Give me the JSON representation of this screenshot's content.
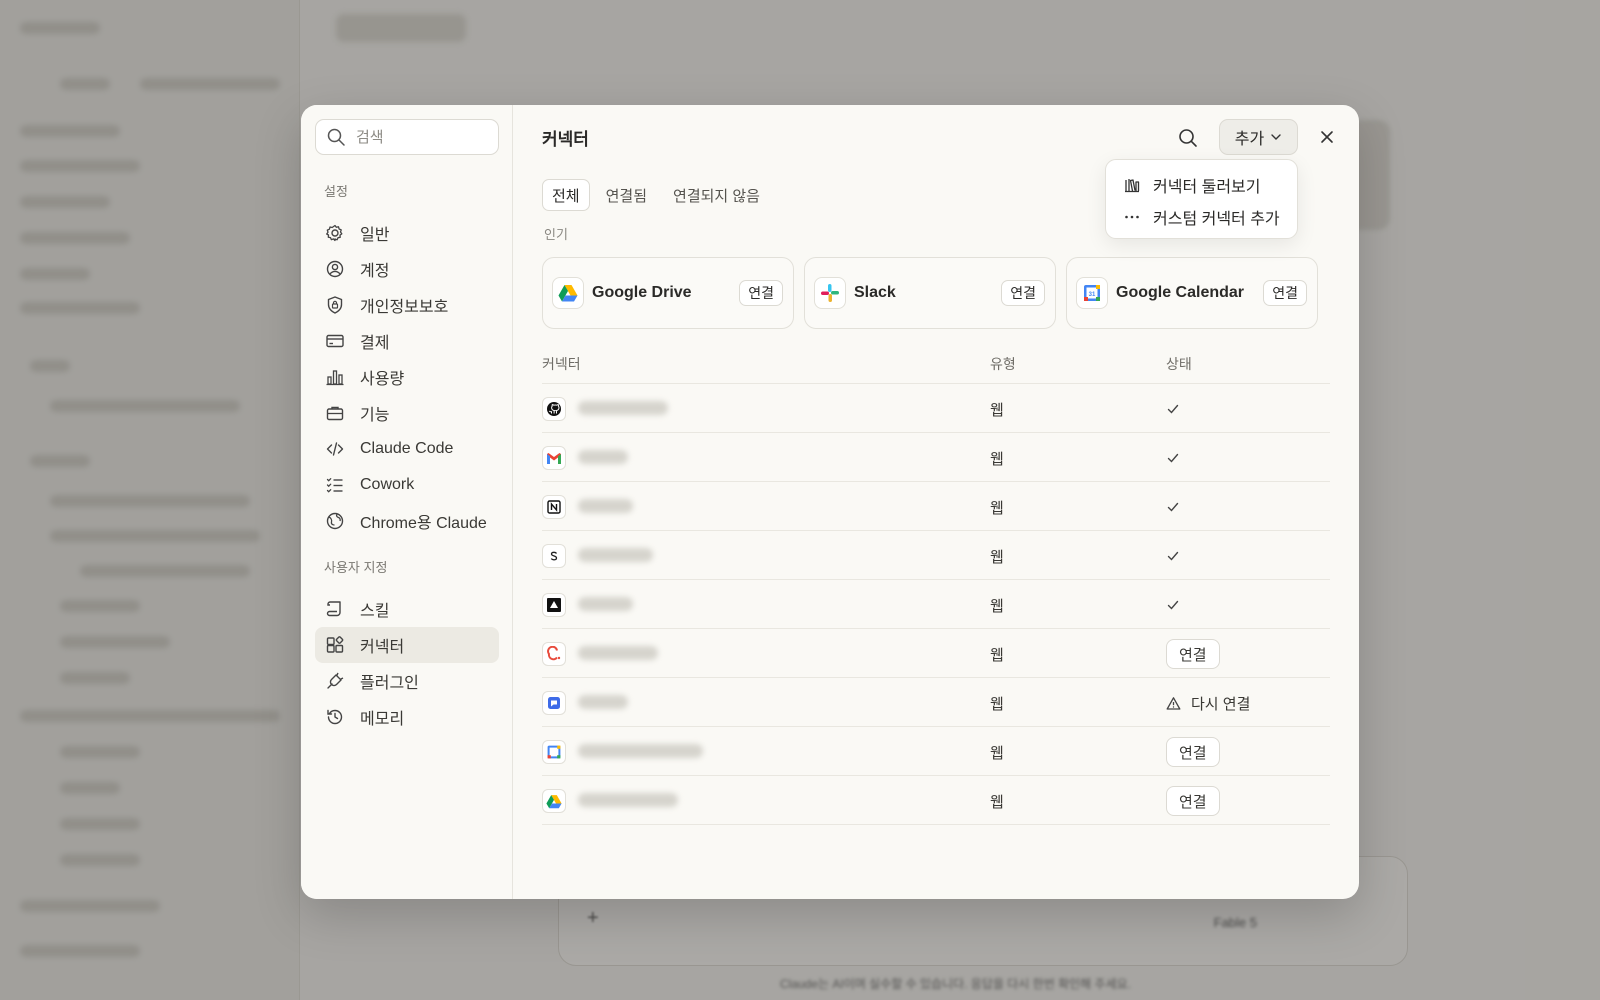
{
  "background": {
    "composer_model": "Fable 5",
    "disclaimer": "Claude는 AI이며 실수할 수 있습니다. 응답을 다시 한번 확인해 주세요."
  },
  "settings": {
    "search_placeholder": "검색",
    "section_settings": "설정",
    "nav": [
      {
        "label": "일반",
        "icon": "gear-icon"
      },
      {
        "label": "계정",
        "icon": "user-circle-icon"
      },
      {
        "label": "개인정보보호",
        "icon": "shield-lock-icon"
      },
      {
        "label": "결제",
        "icon": "credit-card-icon"
      },
      {
        "label": "사용량",
        "icon": "bar-chart-icon"
      },
      {
        "label": "기능",
        "icon": "briefcase-icon"
      },
      {
        "label": "Claude Code",
        "icon": "code-icon"
      },
      {
        "label": "Cowork",
        "icon": "checklist-icon"
      },
      {
        "label": "Chrome용 Claude",
        "icon": "globe-icon"
      }
    ],
    "section_custom": "사용자 지정",
    "custom_nav": [
      {
        "label": "스킬",
        "icon": "scroll-icon"
      },
      {
        "label": "커넥터",
        "icon": "connector-icon",
        "active": true
      },
      {
        "label": "플러그인",
        "icon": "plug-icon"
      },
      {
        "label": "메모리",
        "icon": "history-icon"
      }
    ]
  },
  "connectors": {
    "title": "커넥터",
    "add_label": "추가",
    "menu": [
      {
        "label": "커넥터 둘러보기",
        "icon": "library-icon"
      },
      {
        "label": "커스텀 커넥터 추가",
        "icon": "more-dots-icon"
      }
    ],
    "tabs": [
      "전체",
      "연결됨",
      "연결되지 않음"
    ],
    "active_tab": "전체",
    "popular_label": "인기",
    "popular": [
      {
        "name": "Google Drive",
        "action": "연결",
        "icon": "google-drive-icon"
      },
      {
        "name": "Slack",
        "action": "연결",
        "icon": "slack-icon"
      },
      {
        "name": "Google Calendar",
        "action": "연결",
        "icon": "google-calendar-icon"
      }
    ],
    "columns": {
      "name": "커넥터",
      "type": "유형",
      "status": "상태"
    },
    "rows": [
      {
        "icon": "github-icon",
        "type": "웹",
        "status": "connected"
      },
      {
        "icon": "gmail-icon",
        "type": "웹",
        "status": "connected"
      },
      {
        "icon": "notion-icon",
        "type": "웹",
        "status": "connected"
      },
      {
        "icon": "s-letter-icon",
        "type": "웹",
        "status": "connected"
      },
      {
        "icon": "triangle-logo-icon",
        "type": "웹",
        "status": "connected"
      },
      {
        "icon": "c-logo-icon",
        "type": "웹",
        "status": "connect",
        "action": "연결"
      },
      {
        "icon": "chat-bubble-icon",
        "type": "웹",
        "status": "reconnect",
        "action": "다시 연결"
      },
      {
        "icon": "google-calendar-icon",
        "type": "웹",
        "status": "connect",
        "action": "연결"
      },
      {
        "icon": "google-drive-icon",
        "type": "웹",
        "status": "connect",
        "action": "연결"
      }
    ]
  }
}
